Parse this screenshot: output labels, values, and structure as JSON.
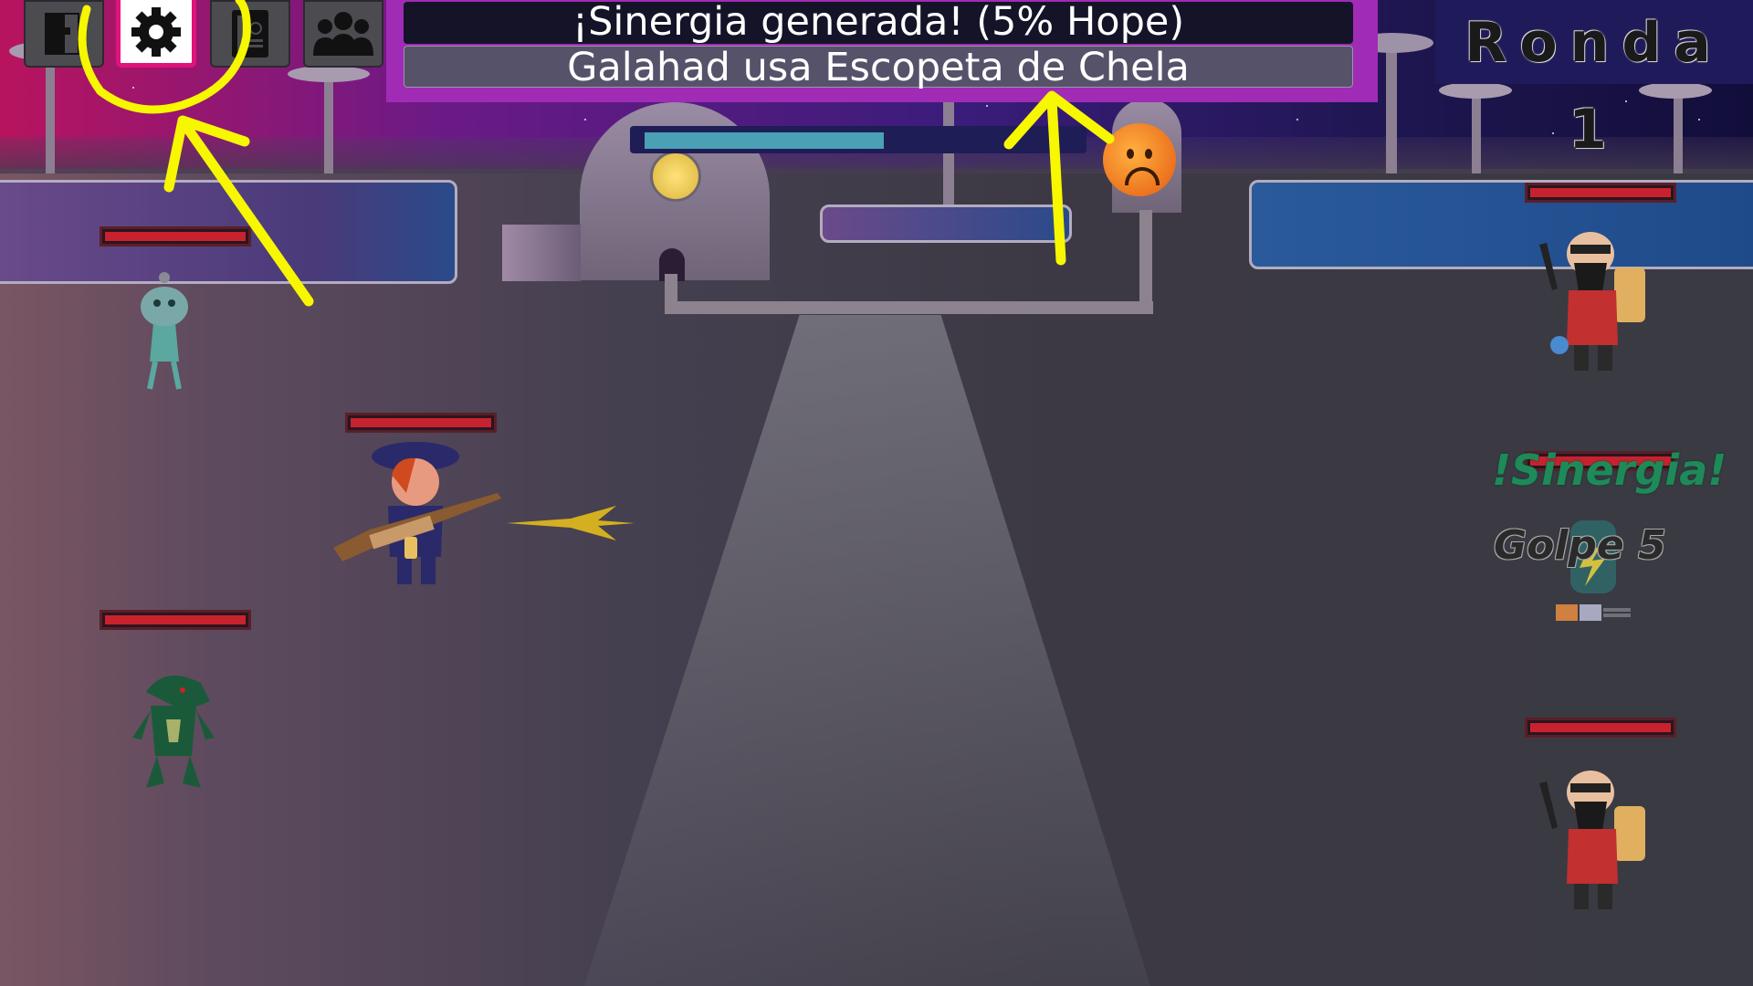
{
  "toolbar": {
    "buttons": [
      {
        "icon": "book-icon"
      },
      {
        "icon": "gear-icon"
      },
      {
        "icon": "inventory-icon"
      },
      {
        "icon": "party-icon"
      }
    ],
    "active_button": "gear-icon"
  },
  "battle_log": {
    "line1": "¡Sinergia generada! (5% Hope)",
    "line2": "Galahad usa Escopeta de Chela"
  },
  "round": {
    "label": "Ronda 1"
  },
  "hope_meter": {
    "fill_fraction": 0.55,
    "mood_icon": "sad-face-icon"
  },
  "floating_texts": {
    "synergy": "!Sinergia!",
    "hit": "Golpe 5"
  },
  "colors": {
    "highlight_border": "#e0137a",
    "log_panel": "#a02bb5",
    "health_fill": "#c8222e",
    "annotation": "#f7f700",
    "synergy_text": "#1e8a5a"
  }
}
